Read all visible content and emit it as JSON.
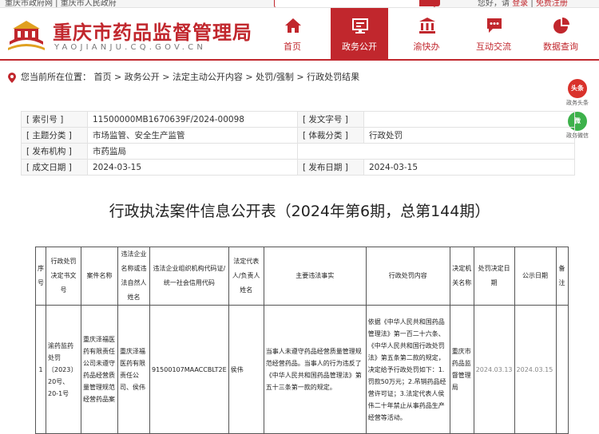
{
  "topbar": {
    "left_text": "重庆市政府网 | 重庆市人民政府",
    "right_prefix": "您好，请",
    "login": "登录",
    "separator": "|",
    "register": "免费注册"
  },
  "header": {
    "title": "重庆市药品监督管理局",
    "subtitle": "YAOJIANJU.CQ.GOV.CN",
    "nav": [
      {
        "label": "首页",
        "icon": "home-icon"
      },
      {
        "label": "政务公开",
        "icon": "gov-open-icon"
      },
      {
        "label": "渝快办",
        "icon": "government-building-icon"
      },
      {
        "label": "互动交流",
        "icon": "chat-icon"
      },
      {
        "label": "数据查询",
        "icon": "pie-chart-icon"
      }
    ]
  },
  "breadcrumb": {
    "prefix": "您当前所在位置：",
    "items": [
      "首页",
      "政务公开",
      "法定主动公开内容",
      "处罚/强制",
      "行政处罚结果"
    ],
    "sep": " > "
  },
  "share": [
    {
      "badge": "头条",
      "label": "政务头条",
      "color": "#d9322b"
    },
    {
      "badge": "微",
      "label": "政务微信",
      "color": "#3db14b"
    }
  ],
  "meta": {
    "index_label": "[ 索引号 ]",
    "index_value": "11500000MB1670639F/2024-00098",
    "docno_label": "[ 发文字号 ]",
    "docno_value": "",
    "topic_label": "[ 主题分类 ]",
    "topic_value": "市场监管、安全生产监管",
    "genre_label": "[ 体裁分类 ]",
    "genre_value": "行政处罚",
    "org_label": "[ 发布机构 ]",
    "org_value": "市药监局",
    "made_label": "[ 成文日期 ]",
    "made_value": "2024-03-15",
    "pub_label": "[ 发布日期 ]",
    "pub_value": "2024-03-15"
  },
  "doc_title": "行政执法案件信息公开表（2024年第6期，总第144期）",
  "table": {
    "headers": [
      "序号",
      "行政处罚决定书文号",
      "案件名称",
      "违法企业名称或违法自然人姓名",
      "违法企业组织机构代码证/统一社会信用代码",
      "法定代表人/负责人姓名",
      "主要违法事实",
      "行政处罚内容",
      "决定机关名称",
      "处罚决定日期",
      "公示日期",
      "备注"
    ],
    "row": {
      "no": "1",
      "docno": "渝药监药处罚〔2023〕20号、20-1号",
      "case_name": "重庆泽福医药有限责任公司未遵守药品经营质量管理规范经营药品案",
      "entity": "重庆泽福医药有限责任公司、侯伟",
      "credit_code": "91500107MAACCBLT2E",
      "rep": "侯伟",
      "facts": "当事人未遵守药品经营质量管理规范经营药品。当事人的行为违反了《中华人民共和国药品管理法》第五十三条第一款的规定。",
      "penalty": "依据《中华人民共和国药品管理法》第一百二十六条、《中华人民共和国行政处罚法》第五条第二款的规定，决定给予行政处罚如下：1.罚款50万元；2.吊销药品经营许可证；3.法定代表人侯伟二十年禁止从事药品生产经营等活动。",
      "authority": "重庆市药品监督管理局",
      "decision_date": "2024.03.13",
      "publicity_date": "2024.03.15",
      "remark": ""
    }
  },
  "colors": {
    "brand": "#c1272d",
    "wechat": "#3db14b"
  }
}
